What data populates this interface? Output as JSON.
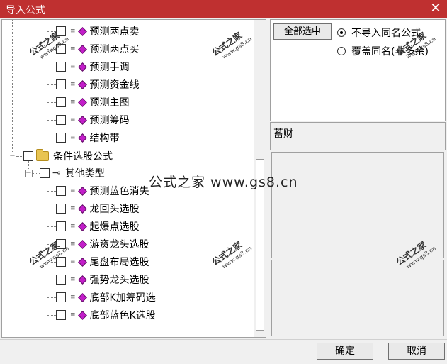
{
  "window": {
    "title": "导入公式",
    "close_glyph": "✕"
  },
  "tree": {
    "items_top": [
      {
        "label": "预测两点卖"
      },
      {
        "label": "预测两点买"
      },
      {
        "label": "预测手调"
      },
      {
        "label": "预测资金线"
      },
      {
        "label": "预测主图"
      },
      {
        "label": "预测筹码"
      },
      {
        "label": "结构带"
      }
    ],
    "group": {
      "label": "条件选股公式",
      "expander": "−"
    },
    "subgroup": {
      "label": "其他类型",
      "expander": "−"
    },
    "items_bottom": [
      {
        "label": "预测蓝色消失"
      },
      {
        "label": "龙回头选股"
      },
      {
        "label": "起爆点选股"
      },
      {
        "label": "游资龙头选股"
      },
      {
        "label": "尾盘布局选股"
      },
      {
        "label": "强势龙头选股"
      },
      {
        "label": "底部K加筹码选"
      },
      {
        "label": "底部蓝色K选股"
      }
    ]
  },
  "options": {
    "select_all_label": "全部选中",
    "radio_no_import": "不导入同名公式",
    "radio_overwrite": "覆盖同名(非多余)"
  },
  "info": {
    "name": "蓄财"
  },
  "watermark": {
    "brand": "公式之家",
    "url": "www.gs8.cn",
    "center": "公式之家 www.gs8.cn"
  },
  "buttons": {
    "ok": "确定",
    "cancel": "取消"
  },
  "colors": {
    "titlebar": "#bf3030",
    "item_icon": "#c21ec9"
  }
}
